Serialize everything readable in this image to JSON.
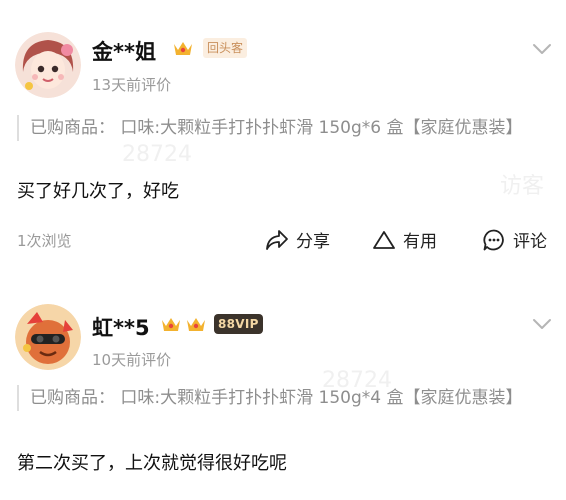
{
  "reviews": [
    {
      "username": "金**姐",
      "badges": [
        "crown-icon",
        "回头客"
      ],
      "time": "13天前评价",
      "product": "已购商品： 口味:大颗粒手打扑扑虾滑 150g*6 盒【家庭优惠装】",
      "content": "买了好几次了，好吃",
      "views": "1次浏览",
      "watermarks": [
        "28724",
        "访客"
      ],
      "actions": {
        "share": "分享",
        "useful": "有用",
        "comment": "评论"
      }
    },
    {
      "username": "虹**5",
      "badges": [
        "crown-icon",
        "crown-icon",
        "88VIP"
      ],
      "time": "10天前评价",
      "product": "已购商品： 口味:大颗粒手打扑扑虾滑 150g*4 盒【家庭优惠装】",
      "content": "第二次买了，上次就觉得很好吃呢",
      "watermarks": [
        "28724"
      ]
    }
  ],
  "colors": {
    "tag_returning_bg": "#fbeee0",
    "tag_vip_bg": "#3b332b",
    "secondary_text": "#9a9a9a"
  }
}
